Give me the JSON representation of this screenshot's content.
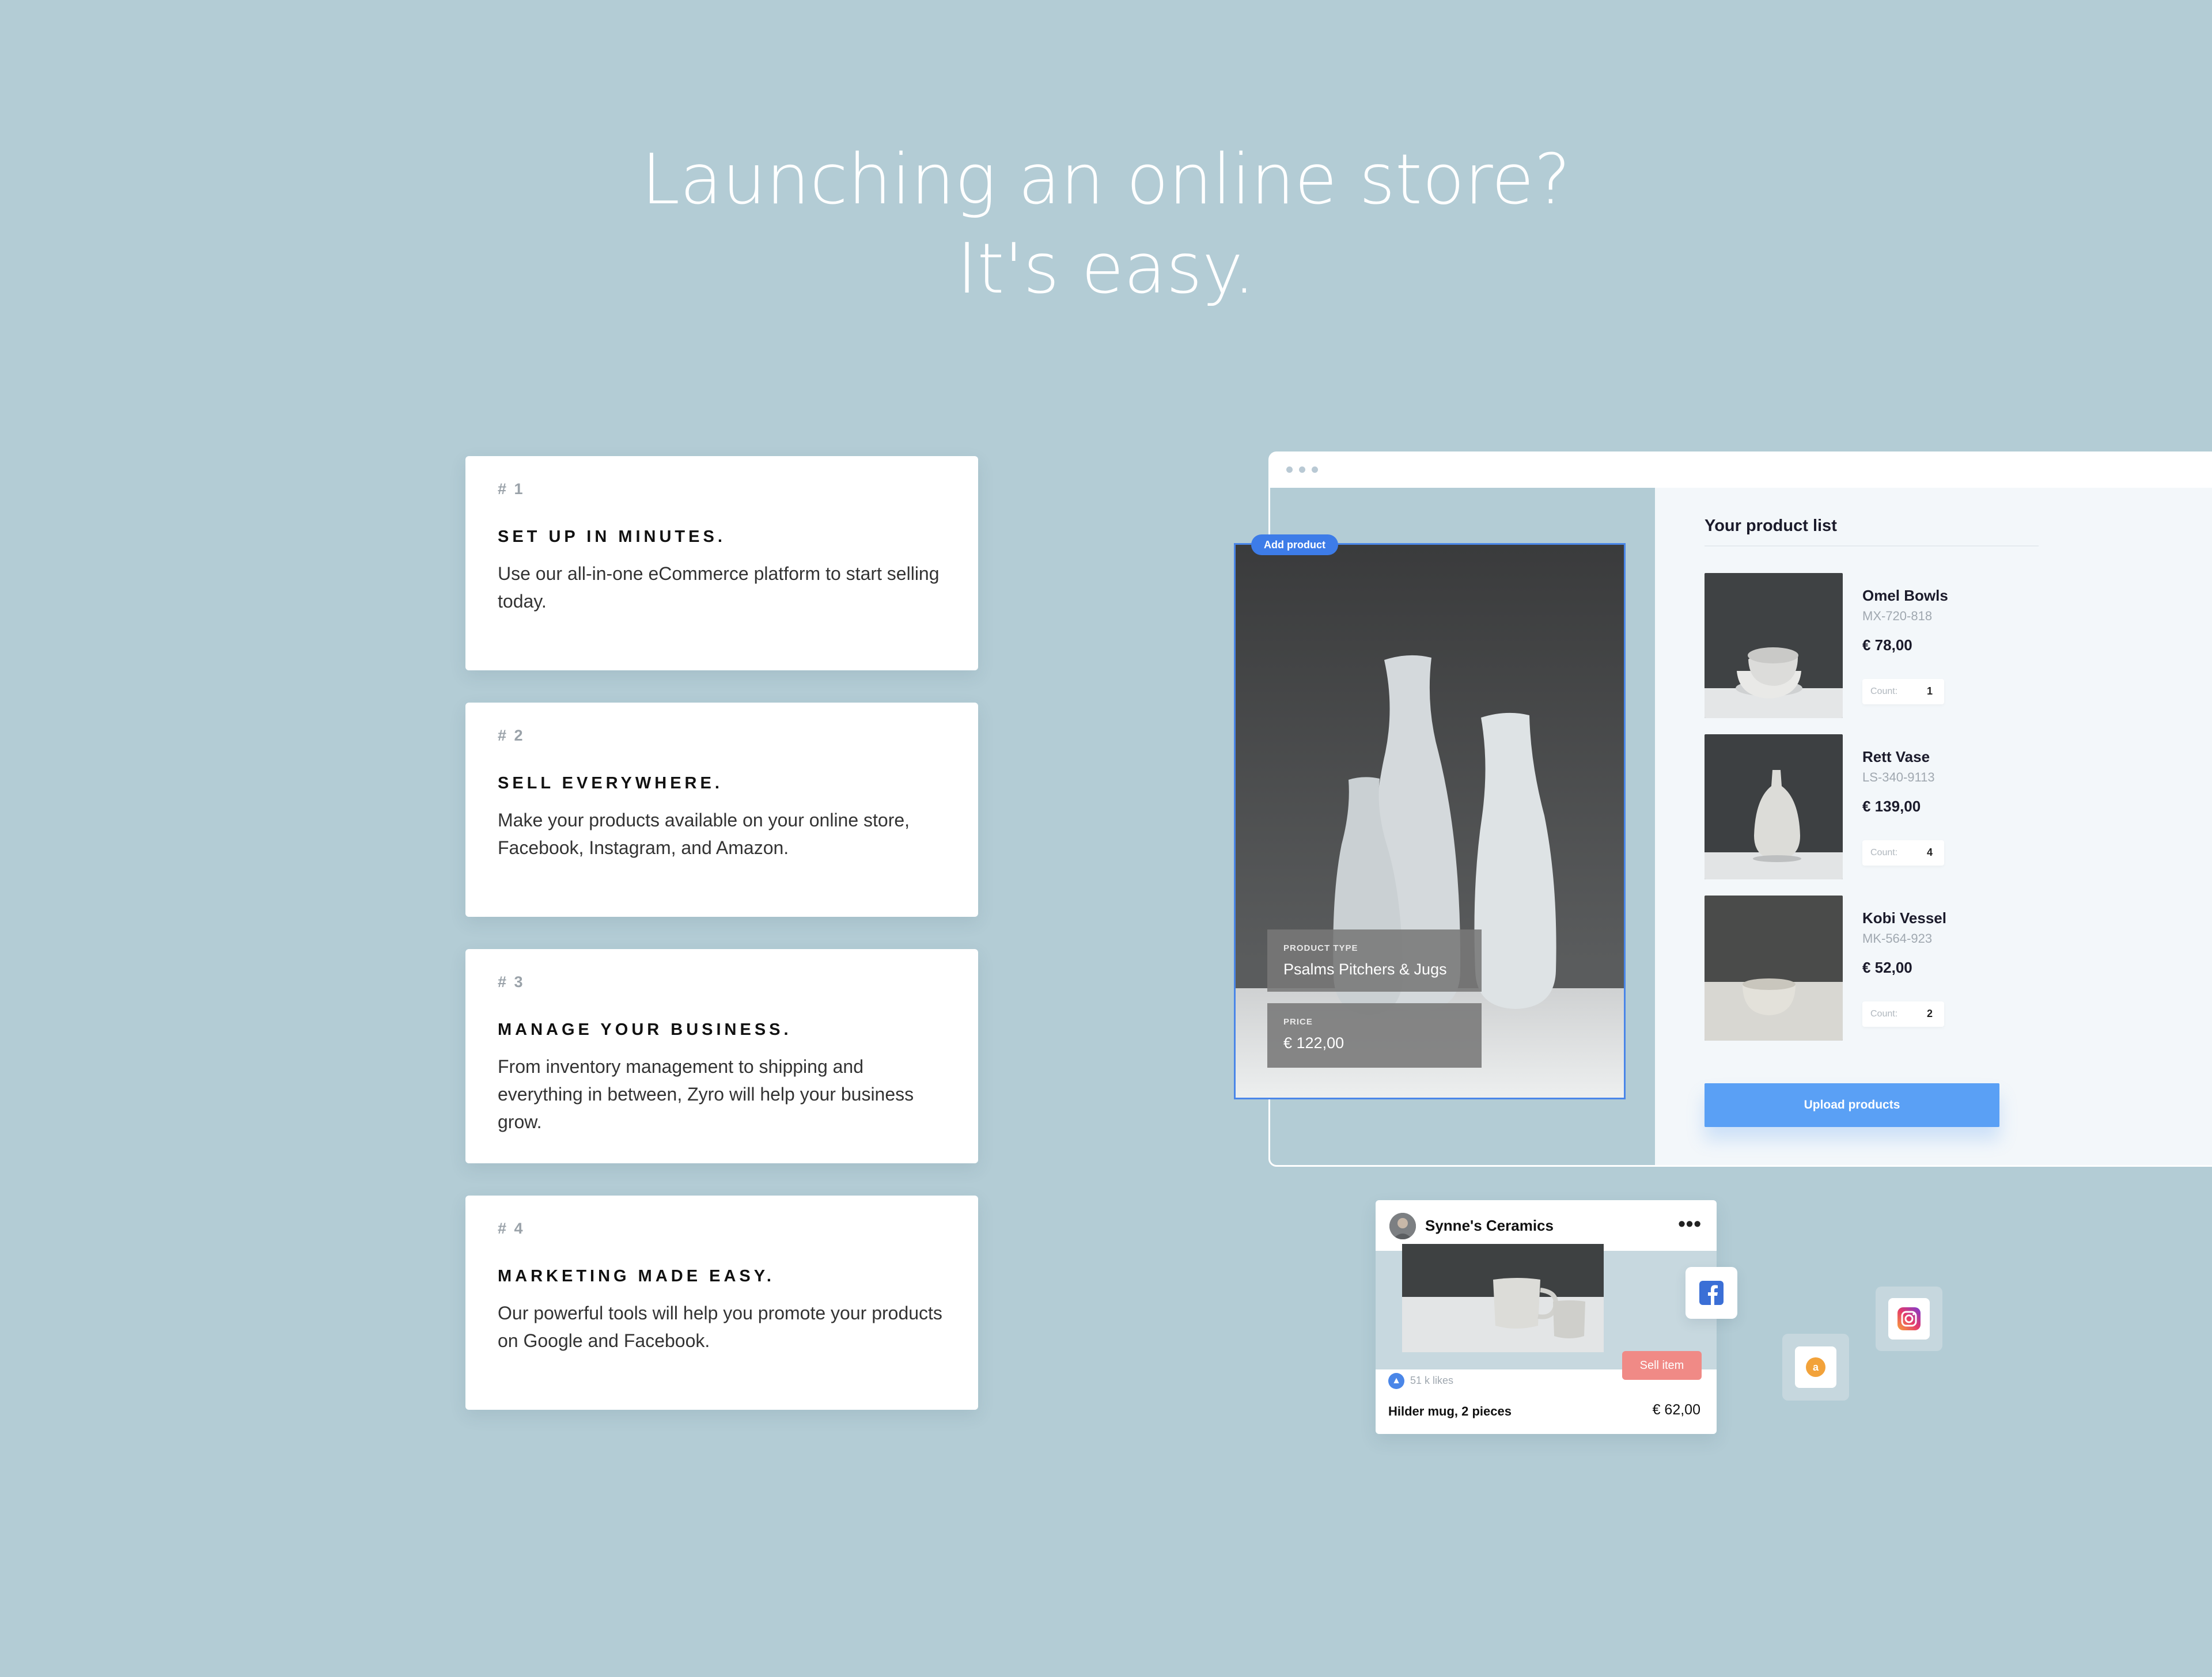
{
  "hero": {
    "line1": "Launching an online store?",
    "line2": "It's easy."
  },
  "features": [
    {
      "number": "# 1",
      "title": "SET UP IN MINUTES.",
      "description": "Use our all-in-one eCommerce platform to start selling today."
    },
    {
      "number": "# 2",
      "title": "SELL EVERYWHERE.",
      "description": "Make your products available on your online store, Facebook, Instagram, and Amazon."
    },
    {
      "number": "# 3",
      "title": "MANAGE YOUR BUSINESS.",
      "description": "From inventory management to shipping and everything in between, Zyro will help your business grow."
    },
    {
      "number": "# 4",
      "title": "MARKETING MADE EASY.",
      "description": "Our powerful tools will help you promote your products on Google and Facebook."
    }
  ],
  "editor": {
    "add_tag": "Add product",
    "product_type_label": "PRODUCT TYPE",
    "product_type_value": "Psalms Pitchers & Jugs",
    "price_label": "PRICE",
    "price_value": "€ 122,00"
  },
  "product_list": {
    "title": "Your product list",
    "count_label": "Count:",
    "items": [
      {
        "name": "Omel Bowls",
        "sku": "MX-720-818",
        "price": "€ 78,00",
        "count": "1"
      },
      {
        "name": "Rett Vase",
        "sku": "LS-340-9113",
        "price": "€ 139,00",
        "count": "4"
      },
      {
        "name": "Kobi Vessel",
        "sku": "MK-564-923",
        "price": "€ 52,00",
        "count": "2"
      }
    ],
    "upload_label": "Upload products"
  },
  "social_post": {
    "store_name": "Synne's Ceramics",
    "more": "•••",
    "sell_label": "Sell item",
    "likes": "51 k likes",
    "item_name": "Hilder mug, 2 pieces",
    "item_price": "€ 62,00"
  },
  "channels": [
    "facebook-icon",
    "amazon-icon",
    "instagram-icon"
  ],
  "colors": {
    "background": "#b3ccd5",
    "accent": "#4a86e8",
    "sell": "#f08a86"
  }
}
